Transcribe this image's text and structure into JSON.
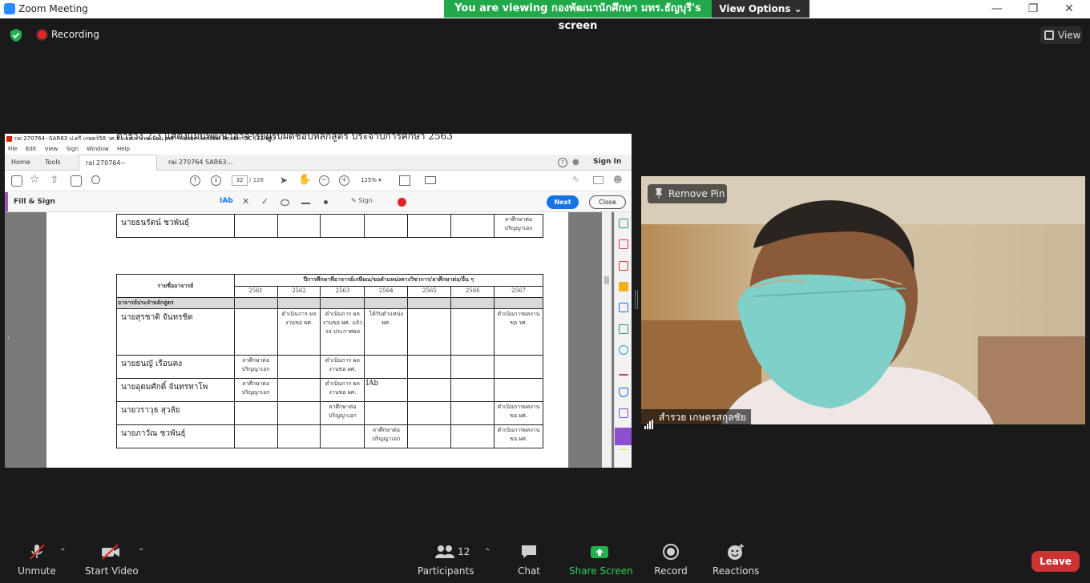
{
  "window": {
    "title": "Zoom Meeting",
    "banner_prefix": "You are viewing",
    "banner_host": "กองพัฒนานักศึกษา มทร.ธัญบุรี's screen",
    "view_options": "View Options"
  },
  "meeting": {
    "recording_label": "Recording",
    "view_label": "View"
  },
  "acrobat": {
    "title": "rai 270764--SAR63 ป.ตรี เกษตร์58 วศ.บ.เเผยเพาะทะเบียน.pdf - Adobe Acrobat Reader DC (32-bit)",
    "menu": [
      "File",
      "Edit",
      "View",
      "Sign",
      "Window",
      "Help"
    ],
    "tabs": [
      "Home",
      "Tools",
      "rai 270764--SAR63...",
      "rai 270764 SAR63..."
    ],
    "sign_in": "Sign In",
    "page_current": "32",
    "page_total": "/ 128",
    "zoom": "125%",
    "fill_sign_label": "Fill & Sign",
    "sign_label": "Sign",
    "next_label": "Next",
    "close_label": "Close",
    "text_cursor": "IAb"
  },
  "pdf": {
    "top_row_name": "นายธนรัตน์ ชวพันธุ์",
    "top_row_note": "ลาศึกษาต่อ ปริญญาเอก",
    "heading": "ตาราง 2.3 แสดงแผนพัฒนาอาจารย์ผู้รับผิดชอบหลักสูตร ประจำปีการศึกษา 2563",
    "col_name": "รายชื่ออาจารย์",
    "col_plan": "ปีการศึกษาที่อาจารย์เกษียณ/ขอตำแหน่งทางวิชาการ/ลาศึกษาต่อ/อื่น ๆ",
    "years": [
      "2561",
      "2562",
      "2563",
      "2564",
      "2565",
      "2566",
      "2567"
    ],
    "section_label": "อาจารย์ประจำหลักสูตร",
    "rows": [
      {
        "name": "นายสุรชาติ จันทรชิต",
        "cells": [
          "",
          "ดำเนินการ ผลงานขอ ผศ.",
          "ดำเนินการ ผลงานขอ ผศ. แล้ว รอ ประกาศผล",
          "ได้รับตำแหน่ง ผศ.",
          "",
          "",
          "ดำเนินการผลงาน ขอ รศ."
        ]
      },
      {
        "name": "นายธนญั เรือนคง",
        "cells": [
          "ลาศึกษาต่อ ปริญญาเอก",
          "",
          "ดำเนินการ ผลงานขอ ผศ.",
          "",
          "",
          "",
          ""
        ]
      },
      {
        "name": "นายอุดมศักดิ์ จันทรทาโพ",
        "cells": [
          "ลาศึกษาต่อ ปริญญาเอก",
          "",
          "ดำเนินการ ผลงานขอ ผศ.",
          "",
          "",
          "",
          ""
        ]
      },
      {
        "name": "นายวราวุธ สุวลัย",
        "cells": [
          "",
          "",
          "ลาศึกษาต่อ ปริญญาเอก",
          "",
          "",
          "",
          "ดำเนินการผลงาน ขอ ผศ."
        ]
      },
      {
        "name": "นายภาวัณ ชวพันธุ์",
        "cells": [
          "",
          "",
          "",
          "ลาศึกษาต่อ ปริญญาเอก",
          "",
          "",
          "ดำเนินการผลงาน ขอ ผศ."
        ]
      }
    ]
  },
  "video": {
    "remove_pin": "Remove Pin",
    "participant_name": "สำรวย เกษตรสกุลชัย"
  },
  "controls": {
    "unmute": "Unmute",
    "start_video": "Start Video",
    "participants": "Participants",
    "participants_count": "12",
    "chat": "Chat",
    "share_screen": "Share Screen",
    "record": "Record",
    "reactions": "Reactions",
    "leave": "Leave"
  },
  "colors": {
    "banner_green": "#21a84a",
    "leave_red": "#cc3333",
    "share_green": "#22b24c",
    "acrobat_blue": "#1473e6"
  }
}
